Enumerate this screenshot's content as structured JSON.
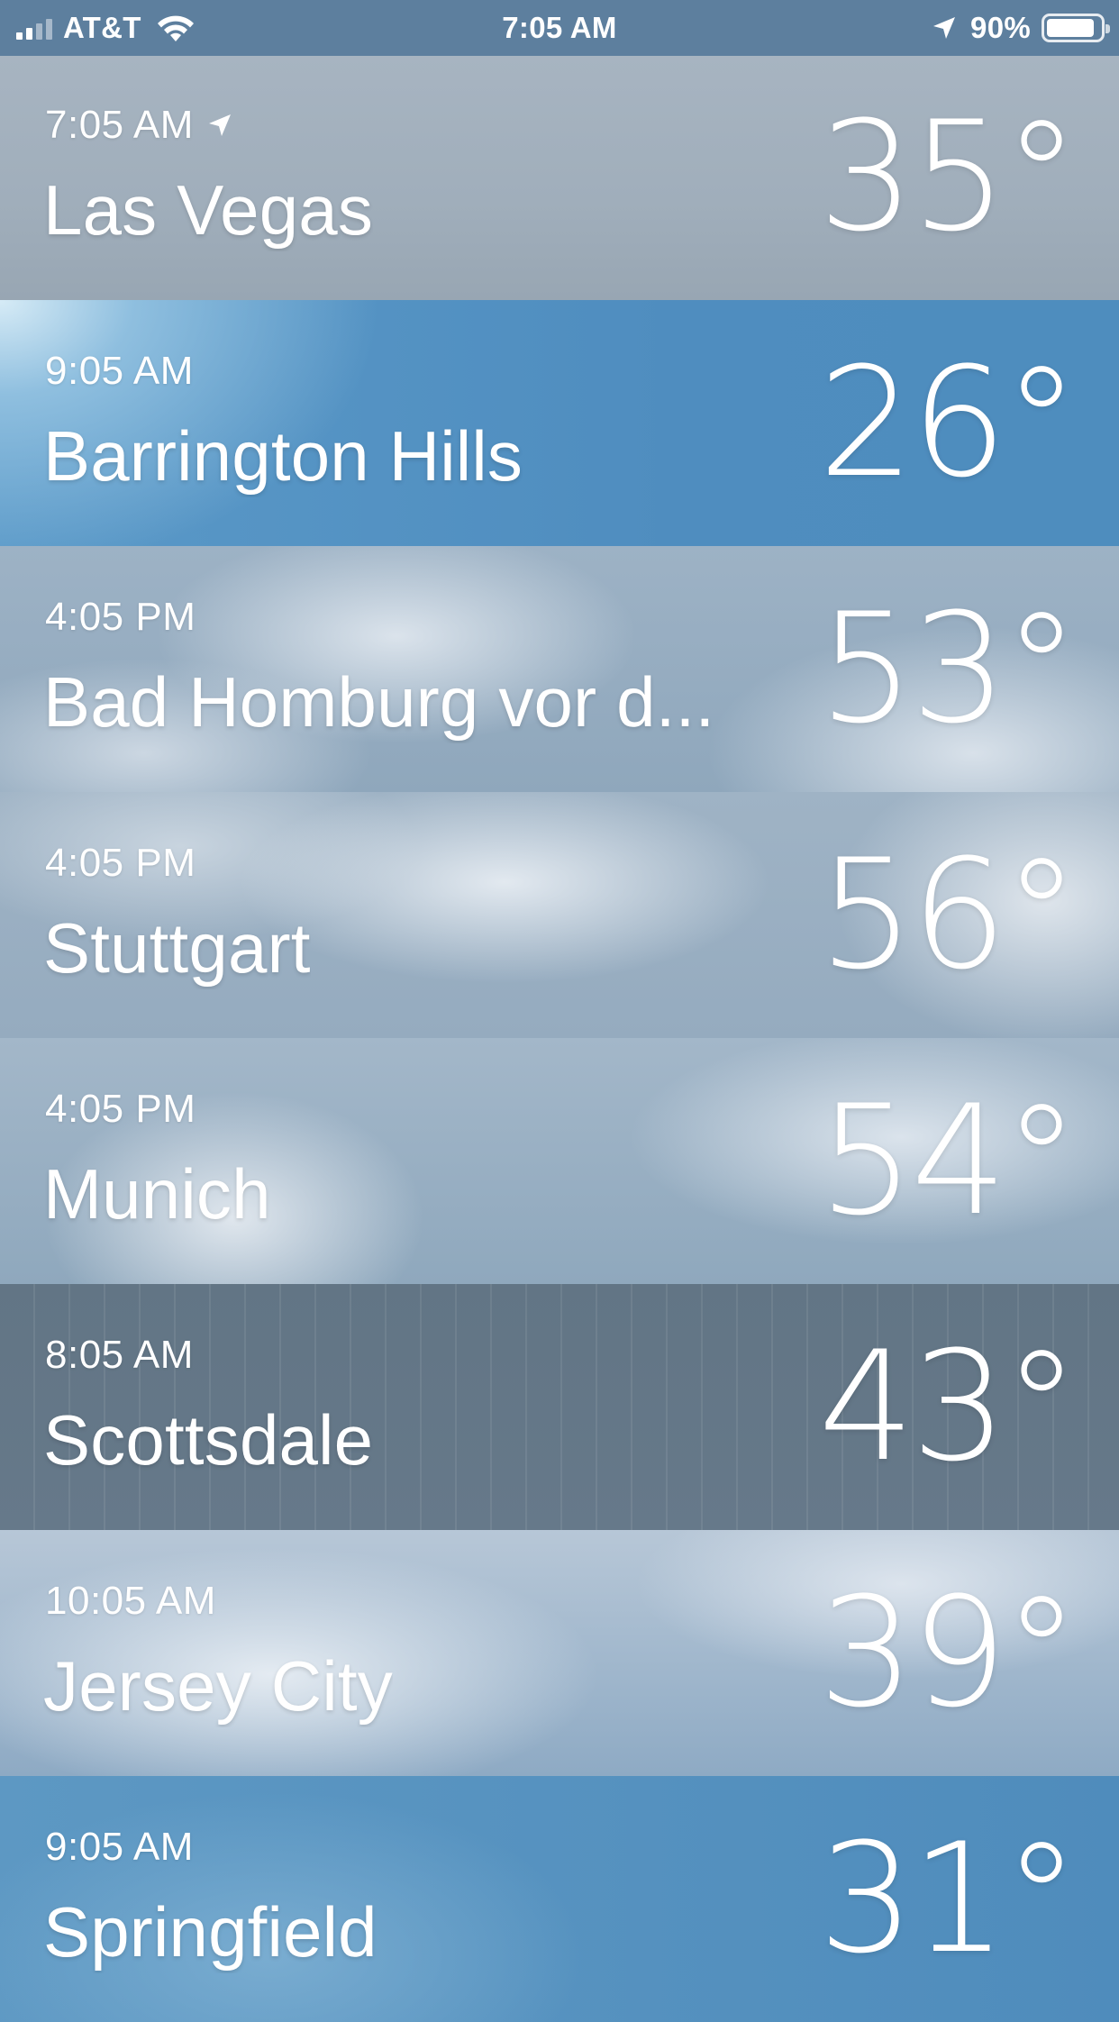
{
  "status_bar": {
    "carrier": "AT&T",
    "time": "7:05 AM",
    "battery_percent": "90%",
    "battery_level": 0.9,
    "signal_bars": 2,
    "wifi_icon": "wifi-icon",
    "location_icon": "location-arrow-icon"
  },
  "cities": [
    {
      "time": "7:05 AM",
      "name": "Las Vegas",
      "temp": "35°",
      "current_location": true
    },
    {
      "time": "9:05 AM",
      "name": "Barrington Hills",
      "temp": "26°"
    },
    {
      "time": "4:05 PM",
      "name": "Bad Homburg vor d...",
      "temp": "53°"
    },
    {
      "time": "4:05 PM",
      "name": "Stuttgart",
      "temp": "56°"
    },
    {
      "time": "4:05 PM",
      "name": "Munich",
      "temp": "54°"
    },
    {
      "time": "8:05 AM",
      "name": "Scottsdale",
      "temp": "43°"
    },
    {
      "time": "10:05 AM",
      "name": "Jersey City",
      "temp": "39°"
    },
    {
      "time": "9:05 AM",
      "name": "Springfield",
      "temp": "31°"
    }
  ],
  "colors": {
    "vegas": "#a0aebb",
    "barrington": "#4f8dbf",
    "scottsdale": "#647787",
    "springfield": "#4f8cbc"
  }
}
